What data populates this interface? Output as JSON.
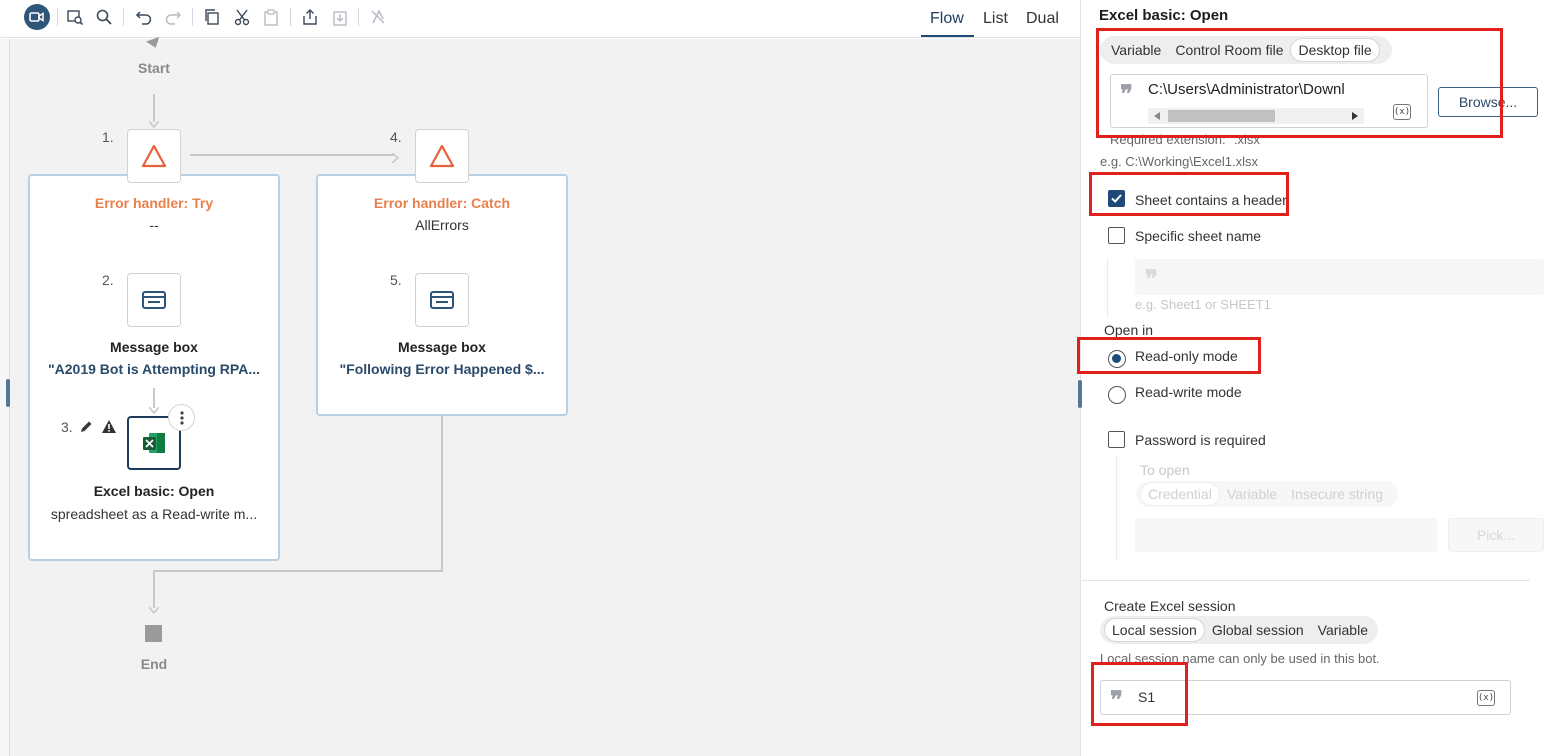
{
  "toolbar": {
    "icons": [
      "record-icon",
      "search-preview-icon",
      "search-icon",
      "undo-icon",
      "redo-icon",
      "copy-icon",
      "cut-icon",
      "paste-icon",
      "export-icon",
      "import-icon",
      "disable-icon"
    ],
    "views": [
      "Flow",
      "List",
      "Dual"
    ],
    "active_view": "Flow"
  },
  "flow": {
    "start_label": "Start",
    "end_label": "End",
    "nodes": [
      {
        "num": "1.",
        "title": "Error handler: Try",
        "subtitle": "--",
        "icon": "warning-triangle-icon"
      },
      {
        "num": "2.",
        "title": "Message box",
        "subtitle": "\"A2019 Bot is Attempting RPA...",
        "icon": "message-box-icon"
      },
      {
        "num": "3.",
        "title": "Excel basic: Open",
        "subtitle": "spreadsheet as a Read-write m...",
        "icon": "excel-icon"
      },
      {
        "num": "4.",
        "title": "Error handler: Catch",
        "subtitle": "AllErrors",
        "icon": "warning-triangle-icon"
      },
      {
        "num": "5.",
        "title": "Message box",
        "subtitle": "\"Following Error Happened $...",
        "icon": "message-box-icon"
      }
    ]
  },
  "panel": {
    "title": "Excel basic: Open",
    "file_source": {
      "options": [
        "Variable",
        "Control Room file",
        "Desktop file"
      ],
      "selected": "Desktop file"
    },
    "file_path": "C:\\Users\\Administrator\\Downl",
    "browse_label": "Browse...",
    "required_ext": "Required extension: \".xlsx\"",
    "example_path": "e.g. C:\\Working\\Excel1.xlsx",
    "sheet_header": {
      "label": "Sheet contains a header",
      "checked": true
    },
    "specific_sheet": {
      "label": "Specific sheet name",
      "checked": false,
      "placeholder": "e.g. Sheet1 or SHEET1"
    },
    "open_in": {
      "label": "Open in",
      "options": [
        {
          "label": "Read-only mode",
          "checked": true
        },
        {
          "label": "Read-write mode",
          "checked": false
        }
      ]
    },
    "password": {
      "label": "Password is required",
      "checked": false,
      "to_open": "To open",
      "options": [
        "Credential",
        "Variable",
        "Insecure string"
      ],
      "pick_label": "Pick..."
    },
    "session": {
      "label": "Create Excel session",
      "options": [
        "Local session",
        "Global session",
        "Variable"
      ],
      "selected": "Local session",
      "hint": "Local session name can only be used in this bot.",
      "value": "S1"
    },
    "var_icon_text": "(x)",
    "highlight_color": "#e0201b",
    "accent_color": "#1f4a78",
    "orange_color": "#e8804c"
  }
}
